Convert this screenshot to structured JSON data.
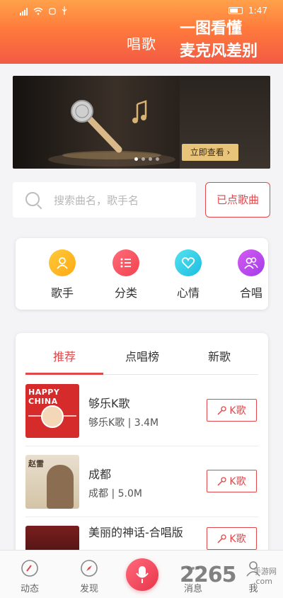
{
  "status_bar": {
    "time": "1:47"
  },
  "header": {
    "title": "唱歌"
  },
  "banner": {
    "line1": "一图看懂",
    "line2": "麦克风差别",
    "button": "立即查看 ›"
  },
  "search": {
    "placeholder": "搜索曲名，歌手名"
  },
  "ordered_button": "已点歌曲",
  "categories": [
    {
      "label": "歌手",
      "icon": "singer-icon"
    },
    {
      "label": "分类",
      "icon": "list-icon"
    },
    {
      "label": "心情",
      "icon": "heart-icon"
    },
    {
      "label": "合唱",
      "icon": "duet-icon"
    }
  ],
  "tabs": [
    "推荐",
    "点唱榜",
    "新歌"
  ],
  "songs": [
    {
      "name": "够乐K歌",
      "meta": "够乐K歌 | 3.4M",
      "cover_text": "HAPPY CHINA",
      "action": "K歌"
    },
    {
      "name": "成都",
      "meta": "成都 | 5.0M",
      "cover_text": "赵雷",
      "action": "K歌"
    },
    {
      "name": "美丽的神话-合唱版",
      "meta": "",
      "action": "K歌"
    }
  ],
  "bottom_nav": [
    {
      "label": "动态",
      "icon": "dynamic-icon"
    },
    {
      "label": "发现",
      "icon": "compass-icon"
    },
    {
      "label": "",
      "icon": "mic-icon"
    },
    {
      "label": "消息",
      "icon": "message-icon"
    },
    {
      "label": "我",
      "icon": "user-icon"
    }
  ],
  "watermark": {
    "main": "2265",
    "top": "手游网",
    "sub": ".com"
  },
  "colors": {
    "accent": "#e0484b",
    "header_top": "#ffa24a",
    "header_bottom": "#f25a44"
  }
}
